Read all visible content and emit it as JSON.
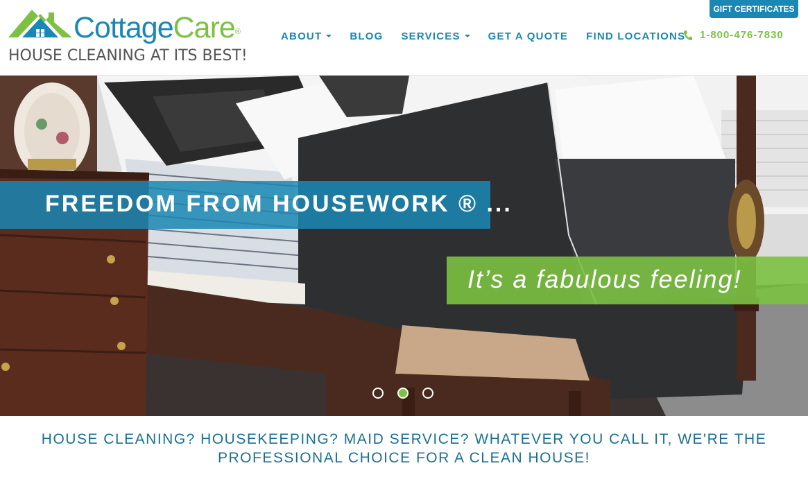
{
  "logo": {
    "brand_part1": "Cottage",
    "brand_part2": "Care",
    "registered": "®",
    "tagline": "HOUSE CLEANING AT ITS BEST!"
  },
  "header": {
    "gift_label": "GIFT CERTIFICATES",
    "phone": "1-800-476-7830"
  },
  "nav": {
    "items": [
      {
        "label": "ABOUT",
        "dropdown": true
      },
      {
        "label": "BLOG",
        "dropdown": false
      },
      {
        "label": "SERVICES",
        "dropdown": true
      },
      {
        "label": "GET A QUOTE",
        "dropdown": false
      },
      {
        "label": "FIND LOCATIONS",
        "dropdown": false
      }
    ]
  },
  "hero": {
    "headline": "FREEDOM FROM HOUSEWORK ® ...",
    "subline": "It’s a fabulous feeling!",
    "slides": 3,
    "active_slide": 2
  },
  "intro": {
    "line1": "HOUSE CLEANING? HOUSEKEEPING? MAID SERVICE? WHATEVER YOU CALL IT, WE'RE THE",
    "line2": "PROFESSIONAL CHOICE FOR A CLEAN HOUSE!"
  },
  "colors": {
    "brand_blue": "#1a87b4",
    "brand_green": "#7cc142"
  },
  "icons": [
    "house-logo-icon",
    "phone-icon",
    "caret-down-icon"
  ]
}
